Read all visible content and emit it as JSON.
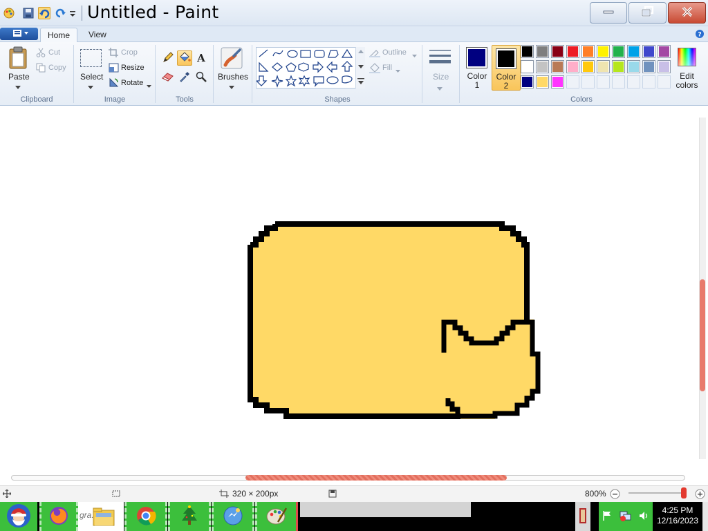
{
  "window": {
    "title": "Untitled - Paint",
    "minimize_icon": "minimize-icon",
    "restore_icon": "restore-icon",
    "close_icon": "close-icon"
  },
  "tabs": [
    {
      "label": "Home",
      "active": true
    },
    {
      "label": "View",
      "active": false
    }
  ],
  "ribbon": {
    "clipboard": {
      "paste": "Paste",
      "cut": "Cut",
      "copy": "Copy",
      "group": "Clipboard"
    },
    "image": {
      "select": "Select",
      "crop": "Crop",
      "resize": "Resize",
      "rotate": "Rotate",
      "group": "Image"
    },
    "tools": {
      "group": "Tools"
    },
    "brushes": {
      "label": "Brushes"
    },
    "shapes": {
      "outline": "Outline",
      "fill": "Fill",
      "group": "Shapes"
    },
    "size": {
      "label": "Size"
    },
    "colors": {
      "color1": "Color 1",
      "color1_line1": "Color",
      "color1_line2": "1",
      "color2_line1": "Color",
      "color2_line2": "2",
      "edit_line1": "Edit",
      "edit_line2": "colors",
      "group": "Colors",
      "color1_value": "#000080",
      "color2_value": "#000000",
      "palette_row1": [
        "#000000",
        "#7f7f7f",
        "#880015",
        "#ed1c24",
        "#ff7f27",
        "#fff200",
        "#22b14c",
        "#00a2e8",
        "#3f48cc",
        "#a349a4"
      ],
      "palette_row2": [
        "#ffffff",
        "#c3c3c3",
        "#b97a57",
        "#ffaec9",
        "#ffc90e",
        "#efe4b0",
        "#b5e61d",
        "#99d9ea",
        "#7092be",
        "#c8bfe7"
      ],
      "palette_row3": [
        "#000080",
        "#ffd966",
        "#ff33ff",
        "",
        "",
        "",
        "",
        "",
        "",
        ""
      ]
    }
  },
  "status": {
    "canvas_size": "320 × 200px",
    "zoom": "800%"
  },
  "taskbar": {
    "folder_label": "gra... d f",
    "time": "4:25 PM",
    "date": "12/16/2023"
  },
  "drawing": {
    "fill_color": "#ffd966",
    "outline_color": "#000000"
  }
}
